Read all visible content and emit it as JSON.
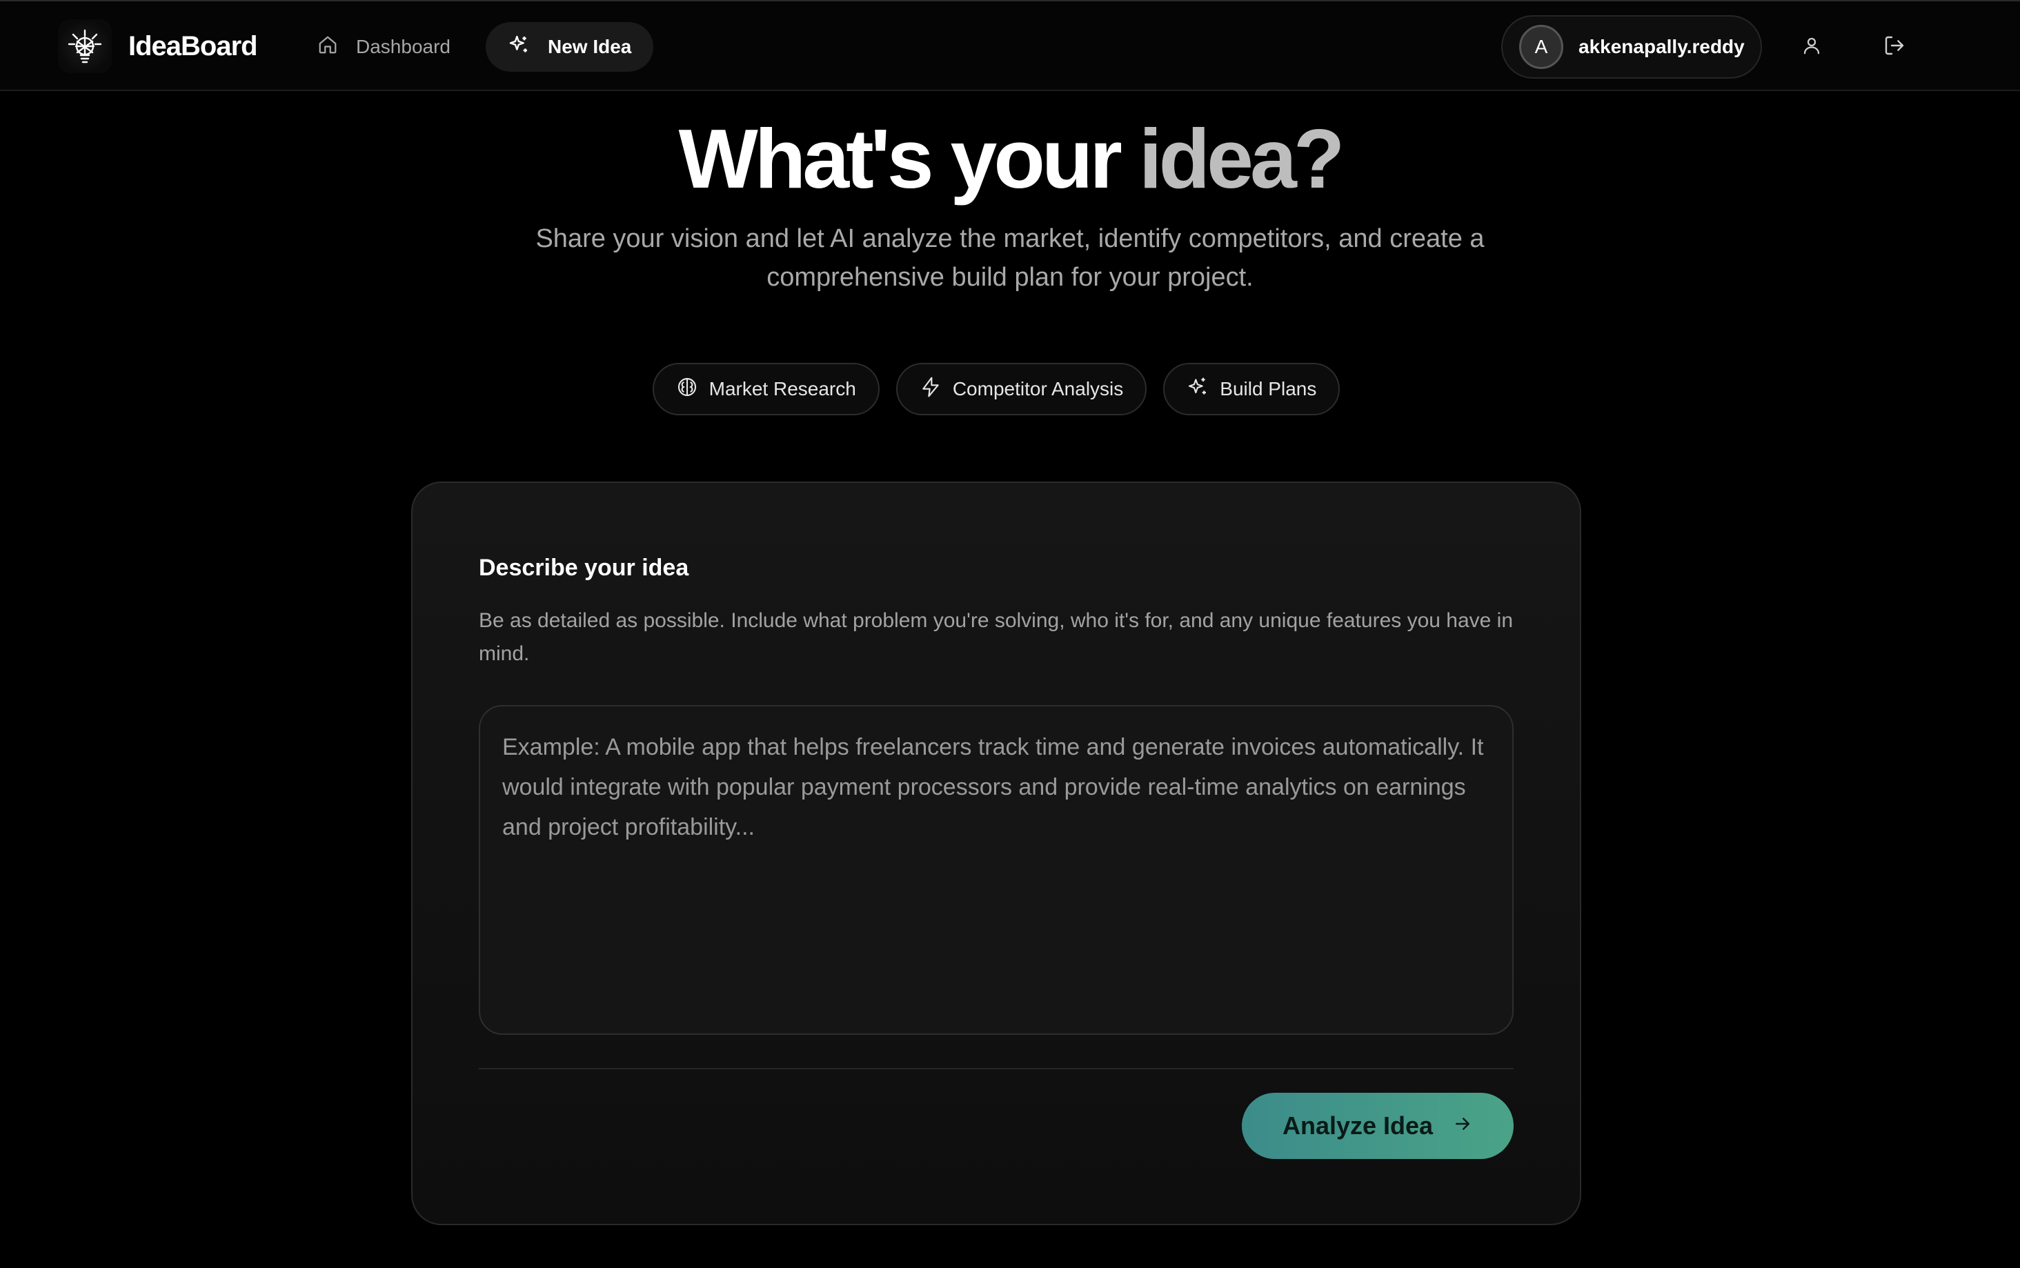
{
  "brand": {
    "name": "IdeaBoard",
    "logo_icon": "lightbulb-burst-icon"
  },
  "nav": {
    "items": [
      {
        "label": "Dashboard",
        "icon": "home-icon",
        "active": false
      },
      {
        "label": "New Idea",
        "icon": "sparkles-icon",
        "active": true
      }
    ]
  },
  "user": {
    "avatar_initial": "A",
    "username": "akkenapally.reddy"
  },
  "header_icons": [
    "user-icon",
    "logout-icon"
  ],
  "hero": {
    "title_white": "What's your ",
    "title_gray": "idea?",
    "subtitle": "Share your vision and let AI analyze the market, identify competitors, and create a comprehensive build plan for your project."
  },
  "chips": [
    {
      "label": "Market Research",
      "icon": "brain-icon"
    },
    {
      "label": "Competitor Analysis",
      "icon": "lightning-icon"
    },
    {
      "label": "Build Plans",
      "icon": "sparkles-icon"
    }
  ],
  "form": {
    "title": "Describe your idea",
    "description": "Be as detailed as possible. Include what problem you're solving, who it's for, and any unique features you have in mind.",
    "placeholder": "Example: A mobile app that helps freelancers track time and generate invoices automatically. It would integrate with popular payment processors and provide real-time analytics on earnings and project profitability...",
    "value": "",
    "submit_label": "Analyze Idea"
  },
  "colors": {
    "background": "#000000",
    "accent_gradient_start": "#3c8c8a",
    "accent_gradient_end": "#4aa387"
  }
}
